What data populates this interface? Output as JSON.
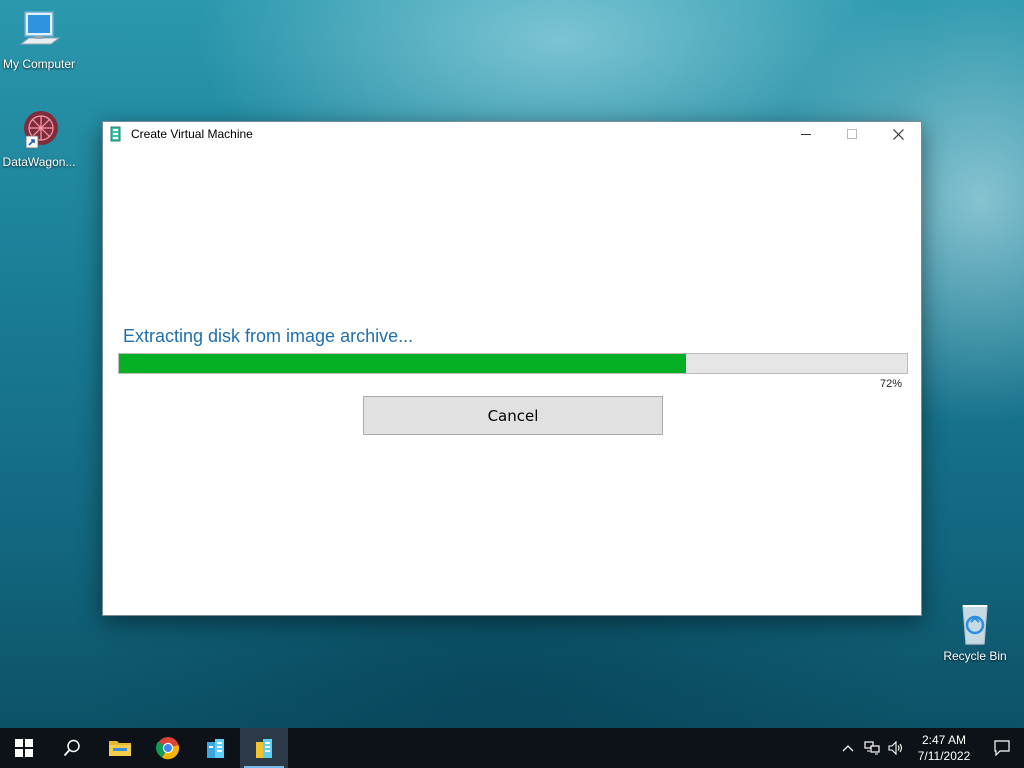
{
  "desktop": {
    "icons": [
      {
        "label": "My Computer",
        "icon": "computer-icon"
      },
      {
        "label": "DataWagon...",
        "icon": "datawagon-shortcut-icon"
      },
      {
        "label": "Recycle Bin",
        "icon": "recycle-bin-icon"
      }
    ]
  },
  "window": {
    "title": "Create Virtual Machine",
    "app_icon": "virtual-machine-app-icon",
    "status_text": "Extracting disk from image archive...",
    "progress": {
      "value": 72,
      "label": "72%"
    },
    "cancel_label": "Cancel",
    "colors": {
      "progress_fill": "#06b025",
      "status_text": "#1f6fae"
    }
  },
  "taskbar": {
    "items": [
      {
        "icon": "start-windows-icon"
      },
      {
        "icon": "search-icon"
      },
      {
        "icon": "file-explorer-icon"
      },
      {
        "icon": "chrome-icon"
      },
      {
        "icon": "server-manager-icon"
      },
      {
        "icon": "virtual-machine-app-icon",
        "active": true
      }
    ],
    "tray": {
      "icons": [
        "chevron-up-icon",
        "network-icon",
        "volume-icon"
      ],
      "time": "2:47 AM",
      "date": "7/11/2022",
      "notification_icon": "notification-icon"
    }
  }
}
